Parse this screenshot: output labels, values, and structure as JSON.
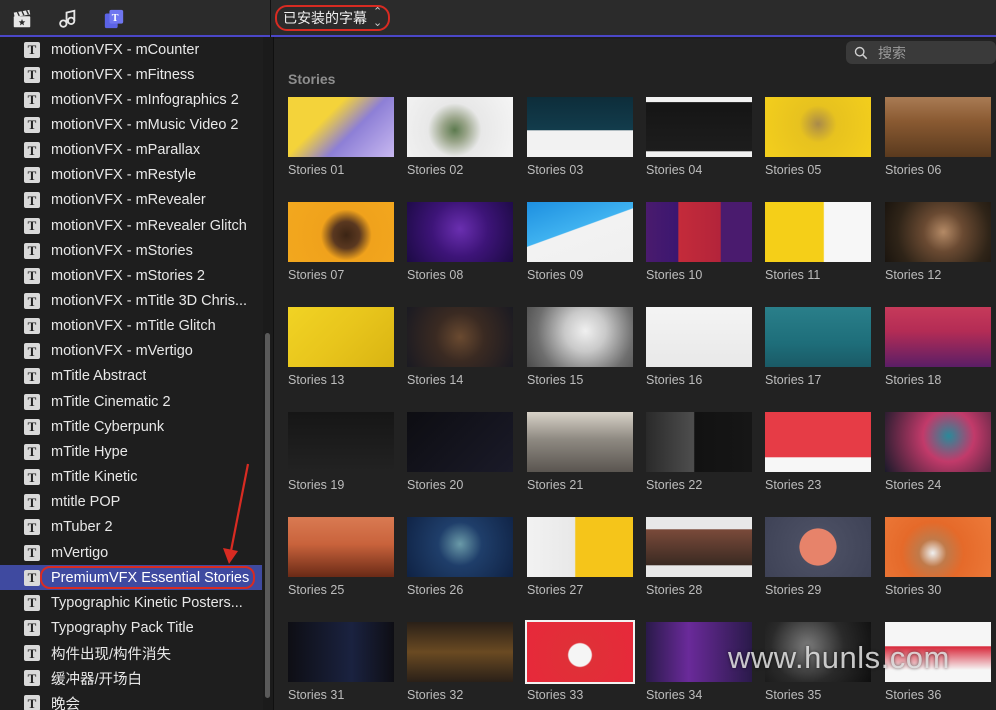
{
  "topbar": {
    "icons": [
      {
        "name": "clapper-icon",
        "color": "#e6e6e6"
      },
      {
        "name": "music-icon",
        "color": "#e6e6e6"
      },
      {
        "name": "titles-icon",
        "color": "#5b63e6"
      }
    ],
    "popup_label": "已安装的字幕",
    "popup_chevron": "⌃⌄"
  },
  "sidebar": {
    "items": [
      {
        "label": "motionVFX - mCounter",
        "icon": "T"
      },
      {
        "label": "motionVFX - mFitness",
        "icon": "T"
      },
      {
        "label": "motionVFX - mInfographics 2",
        "icon": "T"
      },
      {
        "label": "motionVFX - mMusic Video 2",
        "icon": "T"
      },
      {
        "label": "motionVFX - mParallax",
        "icon": "T"
      },
      {
        "label": "motionVFX - mRestyle",
        "icon": "T"
      },
      {
        "label": "motionVFX - mRevealer",
        "icon": "T"
      },
      {
        "label": "motionVFX - mRevealer Glitch",
        "icon": "T"
      },
      {
        "label": "motionVFX - mStories",
        "icon": "T"
      },
      {
        "label": "motionVFX - mStories 2",
        "icon": "T"
      },
      {
        "label": "motionVFX - mTitle 3D Chris...",
        "icon": "T"
      },
      {
        "label": "motionVFX - mTitle Glitch",
        "icon": "T"
      },
      {
        "label": "motionVFX - mVertigo",
        "icon": "T"
      },
      {
        "label": "mTitle Abstract",
        "icon": "T"
      },
      {
        "label": "mTitle Cinematic 2",
        "icon": "T"
      },
      {
        "label": "mTitle Cyberpunk",
        "icon": "T"
      },
      {
        "label": "mTitle Hype",
        "icon": "T"
      },
      {
        "label": "mTitle Kinetic",
        "icon": "T"
      },
      {
        "label": "mtitle POP",
        "icon": "T"
      },
      {
        "label": "mTuber 2",
        "icon": "T"
      },
      {
        "label": "mVertigo",
        "icon": "T"
      },
      {
        "label": "PremiumVFX Essential Stories",
        "icon": "T",
        "selected": true
      },
      {
        "label": "Typographic Kinetic Posters...",
        "icon": "T"
      },
      {
        "label": "Typography Pack Title",
        "icon": "T"
      },
      {
        "label": "构件出现/构件消失",
        "icon": "T"
      },
      {
        "label": "缓冲器/开场白",
        "icon": "T"
      },
      {
        "label": "晚会",
        "icon": "T"
      }
    ]
  },
  "search": {
    "placeholder": "搜索"
  },
  "browser": {
    "section_title": "Stories",
    "tiles": [
      {
        "label": "Stories 01",
        "bg": "linear-gradient(135deg,#f4d33a 0%,#f4d33a 35%,#8d7fd6 60%,#c8b8f0 100%)"
      },
      {
        "label": "Stories 02",
        "bg": "radial-gradient(circle at 45% 55%,#5c7a4e 0%,#9aa58a 18%,#e8e8e8 40%,#f5f5f5 100%)"
      },
      {
        "label": "Stories 03",
        "bg": "linear-gradient(180deg,#0d2d3a 0%,#123c4c 55%,#f2f2f2 56%,#f2f2f2 100%)"
      },
      {
        "label": "Stories 04",
        "bg": "linear-gradient(180deg,#f2f2f2 0%,#f2f2f2 8%,#151515 9%,#1d1d1d 90%,#f2f2f2 91%)"
      },
      {
        "label": "Stories 05",
        "bg": "radial-gradient(circle at 50% 45%,#a98a4a 0%,#e7c21f 30%,#f4cf1c 100%)"
      },
      {
        "label": "Stories 06",
        "bg": "linear-gradient(180deg,#a97b54 0%,#8a5a32 40%,#5a3a1e 100%)"
      },
      {
        "label": "Stories 07",
        "bg": "radial-gradient(circle at 55% 55%,#3b2414 0%,#5a3820 20%,#f0a21c 38%,#f3a81e 100%)"
      },
      {
        "label": "Stories 08",
        "bg": "radial-gradient(circle at 50% 45%,#6a2fb0 0%,#3d1478 45%,#1c0a44 100%)"
      },
      {
        "label": "Stories 09",
        "bg": "linear-gradient(160deg,#1d8fe0 0%,#3fb2f0 45%,#f2f2f2 46%,#f0f0f0 100%)"
      },
      {
        "label": "Stories 10",
        "bg": "linear-gradient(90deg,#4a1b6e 0%,#3b1670 30%,#c42b3a 31%,#b3243a 70%,#4a1b6e 71%)"
      },
      {
        "label": "Stories 11",
        "bg": "linear-gradient(90deg,#f5cf18 0%,#f5cf18 55%,#f7f7f7 56%,#f7f7f7 100%)"
      },
      {
        "label": "Stories 12",
        "bg": "radial-gradient(circle at 55% 50%,#b48a66 0%,#6a4a32 30%,#2f2418 70%,#1a140e 100%)"
      },
      {
        "label": "Stories 13",
        "bg": "linear-gradient(135deg,#f1d324 0%,#e8c51c 50%,#d9b412 100%)"
      },
      {
        "label": "Stories 14",
        "bg": "radial-gradient(circle at 50% 50%,#6a4a30 0%,#3a2a22 40%,#1a1a22 100%)"
      },
      {
        "label": "Stories 15",
        "bg": "radial-gradient(circle at 55% 40%,#f0f0f0 0%,#c9c9c9 30%,#6e6e6e 70%,#4a4a4a 100%)"
      },
      {
        "label": "Stories 16",
        "bg": "linear-gradient(180deg,#f4f4f4 0%,#e8e8e8 100%)"
      },
      {
        "label": "Stories 17",
        "bg": "linear-gradient(180deg,#2a7f8a 0%,#1e6e7a 60%,#1a5a66 100%)"
      },
      {
        "label": "Stories 18",
        "bg": "linear-gradient(180deg,#c63a5a 0%,#b42c55 40%,#5a1e66 100%)"
      },
      {
        "label": "Stories 19",
        "bg": "linear-gradient(180deg,#161616 0%,#222222 100%)"
      },
      {
        "label": "Stories 20",
        "bg": "linear-gradient(135deg,#0d0d12 0%,#1a1a28 100%)"
      },
      {
        "label": "Stories 21",
        "bg": "linear-gradient(180deg,#d8d2c8 0%,#8f8a82 45%,#5a5550 100%)"
      },
      {
        "label": "Stories 22",
        "bg": "linear-gradient(90deg,#2a2a2a 0%,#4e4e4e 45%,#121212 46%,#161616 100%)"
      },
      {
        "label": "Stories 23",
        "bg": "linear-gradient(180deg,#e63c46 0%,#e63c46 75%,#f7f7f7 76%,#f7f7f7 100%)"
      },
      {
        "label": "Stories 24",
        "bg": "radial-gradient(circle at 60% 40%,#2a8a9a 0%,#c23a6a 35%,#1a1a2a 100%)"
      },
      {
        "label": "Stories 25",
        "bg": "linear-gradient(180deg,#d97a52 0%,#c9633c 45%,#6a2a16 100%)"
      },
      {
        "label": "Stories 26",
        "bg": "radial-gradient(circle at 50% 45%,#6a9aa8 0%,#1f3e6a 35%,#0f2244 100%)"
      },
      {
        "label": "Stories 27",
        "bg": "linear-gradient(90deg,#f2f2f2 0%,#e8e8e8 45%,#f5c51a 46%,#f5c51a 100%)"
      },
      {
        "label": "Stories 28",
        "bg": "linear-gradient(180deg,#e8e8e8 0%,#e8e8e8 20%,#7a4a3a 21%,#3a2a22 80%,#e8e8e8 81%)"
      },
      {
        "label": "Stories 29",
        "bg": "radial-gradient(circle at 50% 50%,#e7836a 0%,#e7836a 30%,#4a4e62 31%,#3e4256 100%)"
      },
      {
        "label": "Stories 30",
        "bg": "radial-gradient(circle at 45% 60%,#f0f0f0 0%,#c07a4a 20%,#e56a2a 45%,#ed7a3a 100%)"
      },
      {
        "label": "Stories 31",
        "bg": "linear-gradient(90deg,#0e0e14 0%,#1a2240 60%,#0e0e14 100%)"
      },
      {
        "label": "Stories 32",
        "bg": "linear-gradient(180deg,#2a2018 0%,#6a4a22 50%,#2a2018 100%)"
      },
      {
        "label": "Stories 33",
        "bg": "radial-gradient(circle at 50% 55%,#f5f5f5 0%,#f5f5f5 18%,#e03038 20%,#e8283a 100%)",
        "selected": true
      },
      {
        "label": "Stories 34",
        "bg": "linear-gradient(90deg,#2a1a4a 0%,#6a2a9a 40%,#2a1a4a 100%)"
      },
      {
        "label": "Stories 35",
        "bg": "radial-gradient(circle at 40% 40%,#7a7a7a 0%,#2a2a2a 50%,#0e0e0e 100%)"
      },
      {
        "label": "Stories 36",
        "bg": "linear-gradient(180deg,#f6f6f6 0%,#f6f6f6 40%,#d8283a 41%,#f6f6f6 80%)"
      }
    ]
  },
  "watermark": "www.hunls.com"
}
